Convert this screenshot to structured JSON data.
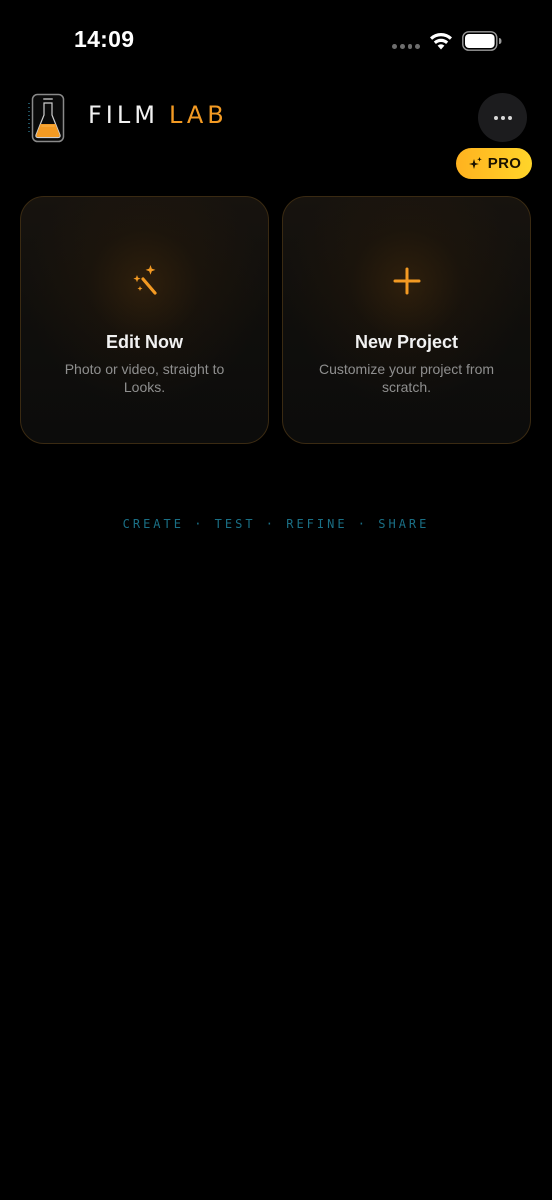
{
  "status_bar": {
    "time": "14:09",
    "icons": [
      "cellular-dots-icon",
      "wifi-icon",
      "battery-icon"
    ]
  },
  "header": {
    "app_name_part1": "FILM",
    "app_name_part2": "LAB",
    "logo_icon": "flask-icon",
    "more_icon": "ellipsis-icon",
    "pro_label": "PRO",
    "pro_icon": "sparkle-icon"
  },
  "cards": [
    {
      "title": "Edit Now",
      "description": "Photo or video, straight to Looks.",
      "icon": "magic-wand-icon"
    },
    {
      "title": "New Project",
      "description": "Customize your project from scratch.",
      "icon": "plus-icon"
    }
  ],
  "tagline": "CREATE · TEST · REFINE · SHARE",
  "colors": {
    "background": "#000000",
    "accent_orange": "#f39a23",
    "pro_gradient_start": "#ffb21f",
    "pro_gradient_end": "#ffd52a",
    "tagline": "#1a6f85",
    "card_border": "#3a2a12"
  }
}
